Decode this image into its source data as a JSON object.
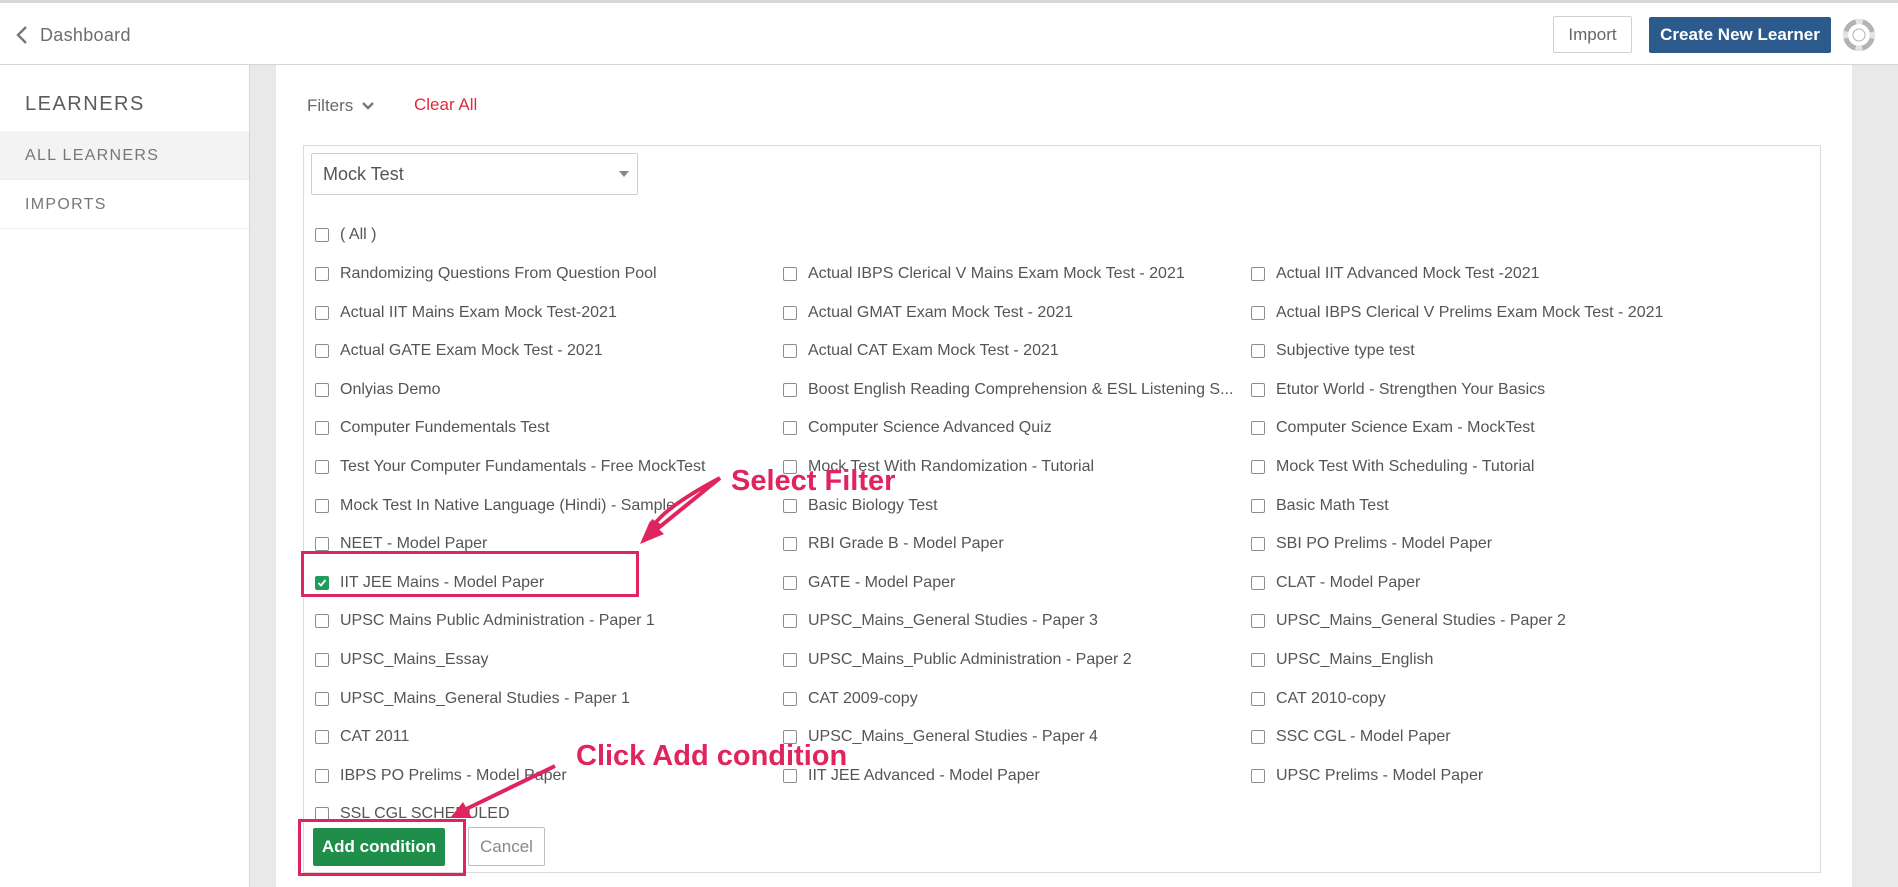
{
  "header": {
    "back_label": "Dashboard",
    "import_label": "Import",
    "create_label": "Create New Learner"
  },
  "sidebar": {
    "title": "LEARNERS",
    "items": [
      {
        "label": "ALL LEARNERS",
        "active": true
      },
      {
        "label": "IMPORTS",
        "active": false
      }
    ]
  },
  "filters": {
    "label": "Filters",
    "clear_all": "Clear All",
    "selected_type": "Mock Test",
    "all_label": "( All )",
    "options": [
      [
        "Randomizing Questions From Question Pool",
        "Actual IBPS Clerical V Mains Exam Mock Test - 2021",
        "Actual IIT Advanced Mock Test -2021"
      ],
      [
        "Actual IIT Mains Exam Mock Test-2021",
        "Actual GMAT Exam Mock Test - 2021",
        "Actual IBPS Clerical V Prelims Exam Mock Test - 2021"
      ],
      [
        "Actual GATE Exam Mock Test - 2021",
        "Actual CAT Exam Mock Test - 2021",
        "Subjective type test"
      ],
      [
        "Onlyias Demo",
        "Boost English Reading Comprehension & ESL Listening S...",
        "Etutor World - Strengthen Your Basics"
      ],
      [
        "Computer Fundementals Test",
        "Computer Science Advanced Quiz",
        "Computer Science Exam - MockTest"
      ],
      [
        "Test Your Computer Fundamentals - Free MockTest",
        "Mock Test With Randomization - Tutorial",
        "Mock Test With Scheduling - Tutorial"
      ],
      [
        "Mock Test In Native Language (Hindi) - Sample",
        "Basic Biology Test",
        "Basic Math Test"
      ],
      [
        "NEET - Model Paper",
        "RBI Grade B - Model Paper",
        "SBI PO Prelims - Model Paper"
      ],
      [
        "IIT JEE Mains - Model Paper",
        "GATE - Model Paper",
        "CLAT - Model Paper"
      ],
      [
        "UPSC Mains Public Administration - Paper 1",
        "UPSC_Mains_General Studies - Paper 3",
        "UPSC_Mains_General Studies - Paper 2"
      ],
      [
        "UPSC_Mains_Essay",
        "UPSC_Mains_Public Administration - Paper 2",
        "UPSC_Mains_English"
      ],
      [
        "UPSC_Mains_General Studies - Paper 1",
        "CAT 2009-copy",
        "CAT 2010-copy"
      ],
      [
        "CAT 2011",
        "UPSC_Mains_General Studies - Paper 4",
        "SSC CGL - Model Paper"
      ],
      [
        "IBPS PO Prelims - Model Paper",
        "IIT JEE Advanced - Model Paper",
        "UPSC Prelims - Model Paper"
      ],
      [
        "SSL CGL SCHEDULED"
      ]
    ],
    "checked": [
      "IIT JEE Mains - Model Paper"
    ],
    "add_label": "Add condition",
    "cancel_label": "Cancel"
  },
  "annotations": {
    "select_filter": "Select Filter",
    "click_add": "Click Add condition",
    "color": "#e0245e"
  }
}
